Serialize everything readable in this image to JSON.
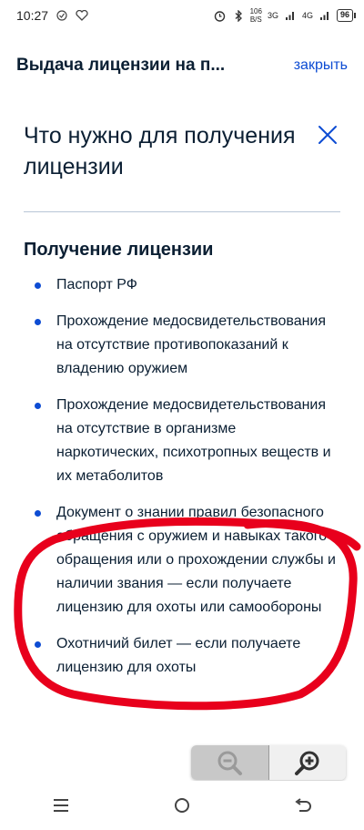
{
  "status_bar": {
    "time": "10:27",
    "net_speed_value": "106",
    "net_speed_unit": "B/S",
    "signal_1": "3G",
    "signal_2": "4G",
    "battery": "96"
  },
  "header": {
    "title": "Выдача лицензии на п...",
    "close_label": "закрыть"
  },
  "card": {
    "title": "Что нужно для получения лицензии"
  },
  "section": {
    "title": "Получение лицензии",
    "items": [
      {
        "text": "Паспорт РФ"
      },
      {
        "text": "Прохождение медосвидетельствования на отсутствие противопоказаний к владению оружием"
      },
      {
        "text": "Прохождение медосвидетельствования на отсутствие в организме наркотических, психотропных веществ и их метаболитов"
      },
      {
        "text": "Документ о знании правил безопасного обращения с оружием и навыках такого обращения или о прохождении службы и наличии звания — если получаете лицензию для охоты или самообороны"
      },
      {
        "text": "Охотничий билет — если получаете лицензию для охоты"
      }
    ]
  },
  "colors": {
    "accent": "#0d4cd3",
    "text": "#0b1f33",
    "annotation": "#e8001c"
  }
}
